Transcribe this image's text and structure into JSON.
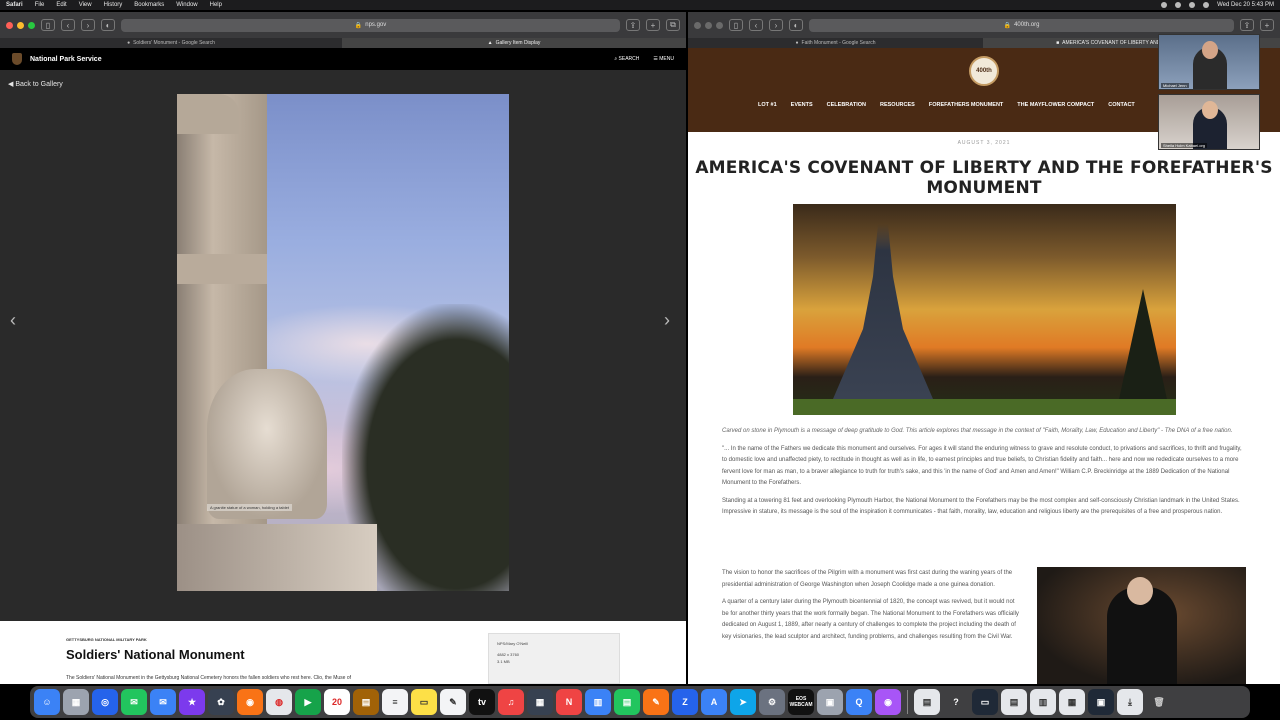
{
  "menubar": {
    "items": [
      "Safari",
      "File",
      "Edit",
      "View",
      "History",
      "Bookmarks",
      "Window",
      "Help"
    ],
    "clock": "Wed Dec 20  5:43 PM"
  },
  "left_window": {
    "url": "nps.gov",
    "tabs": [
      "Soldiers' Monument - Google Search",
      "Gallery Item Display"
    ],
    "site_name": "National Park Service",
    "search_label": "SEARCH",
    "menu_label": "MENU",
    "back_label": "Back to Gallery",
    "photo_caption": "A granite statue of a woman, holding a tablet",
    "park_label": "GETTYSBURG NATIONAL MILITARY PARK",
    "monument_title": "Soldiers' National Monument",
    "intro_text": "The Soldiers' National Monument in the Gettysburg National Cemetery honors the fallen soldiers who rest here. Clio, the Muse of",
    "credit": "NPS/Mary O'Neill",
    "dimensions": "4882 x 3760",
    "filesize": "3.1 MB"
  },
  "right_window": {
    "url": "400th.org",
    "tabs": [
      "Faith Monument - Google Search",
      "AMERICA'S COVENANT OF LIBERTY AND THE FOREFATHE..."
    ],
    "logo_text": "400th",
    "nav": [
      "LOT #1",
      "EVENTS",
      "CELEBRATION",
      "RESOURCES",
      "FOREFATHERS MONUMENT",
      "THE MAYFLOWER COMPACT",
      "CONTACT"
    ],
    "date": "AUGUST 3, 2021",
    "headline": "AMERICA'S COVENANT OF LIBERTY AND THE FOREFATHER'S MONUMENT",
    "lead": "Carved on stone in Plymouth is a message of deep gratitude to God. This article explores that message in the context of \"Faith, Morality, Law, Education and Liberty\" - The DNA of a free nation.",
    "quote": "\"... In the name of the Fathers we dedicate this monument and ourselves. For ages it will stand the enduring witness to grave and resolute conduct, to privations and sacrifices, to thrift and frugality, to domestic love and unaffected piety, to rectitude in thought as well as in life, to earnest principles and true beliefs, to Christian fidelity and faith... here and now we rededicate ourselves to a more fervent love for man as man, to a braver allegiance to truth for truth's sake, and this 'in the name of God' and Amen and Amen!\" William C.P. Breckinridge at the 1889 Dedication of the National Monument to the Forefathers.",
    "para1": "Standing at a towering 81 feet and overlooking Plymouth Harbor, the National Monument to the Forefathers may be the most complex and self-consciously Christian landmark in the United States. Impressive in stature, its message is the soul of the inspiration it communicates - that faith, morality, law, education and religious liberty are the prerequisites of a free and prosperous nation.",
    "para2": "The vision to honor the sacrifices of the Pilgrim with a monument was first cast during the waning years of the presidential administration of George Washington when Joseph Coolidge made a one guinea donation.",
    "para3": "A quarter of a century later during the Plymouth bicentennial of 1820, the concept was revived, but it would not be for another thirty years that the work formally began. The National Monument to the Forefathers was officially dedicated on August 1, 1889, after nearly a century of challenges to complete the project including the death of key visionaries, the lead sculptor and architect, funding problems, and challenges resulting from the Civil War."
  },
  "video": {
    "participant1": "Michael Jenn",
    "participant2": "Sheila Holm Kabaei.org"
  },
  "dock_icons": [
    "finder-icon",
    "launchpad-icon",
    "safari-icon",
    "messages-icon",
    "mail-icon",
    "star-icon",
    "photos-icon",
    "chrome-icon",
    "facetime-icon",
    "calendar-icon",
    "notes-icon",
    "reminders-icon",
    "tv-icon",
    "music-icon",
    "calculator-icon",
    "news-icon",
    "keynote-icon",
    "numbers-icon",
    "zoom-icon",
    "appstore-icon",
    "telegram-icon",
    "settings-icon",
    "webcam-icon",
    "preview-icon",
    "quicktime-icon",
    "podcasts-icon",
    "documents-icon",
    "help-icon",
    "folder-icon",
    "trash-icon"
  ],
  "dock": {
    "calendar_day": "20",
    "tv_label": "tv",
    "webcam_label": "EOS WEBCAM"
  }
}
